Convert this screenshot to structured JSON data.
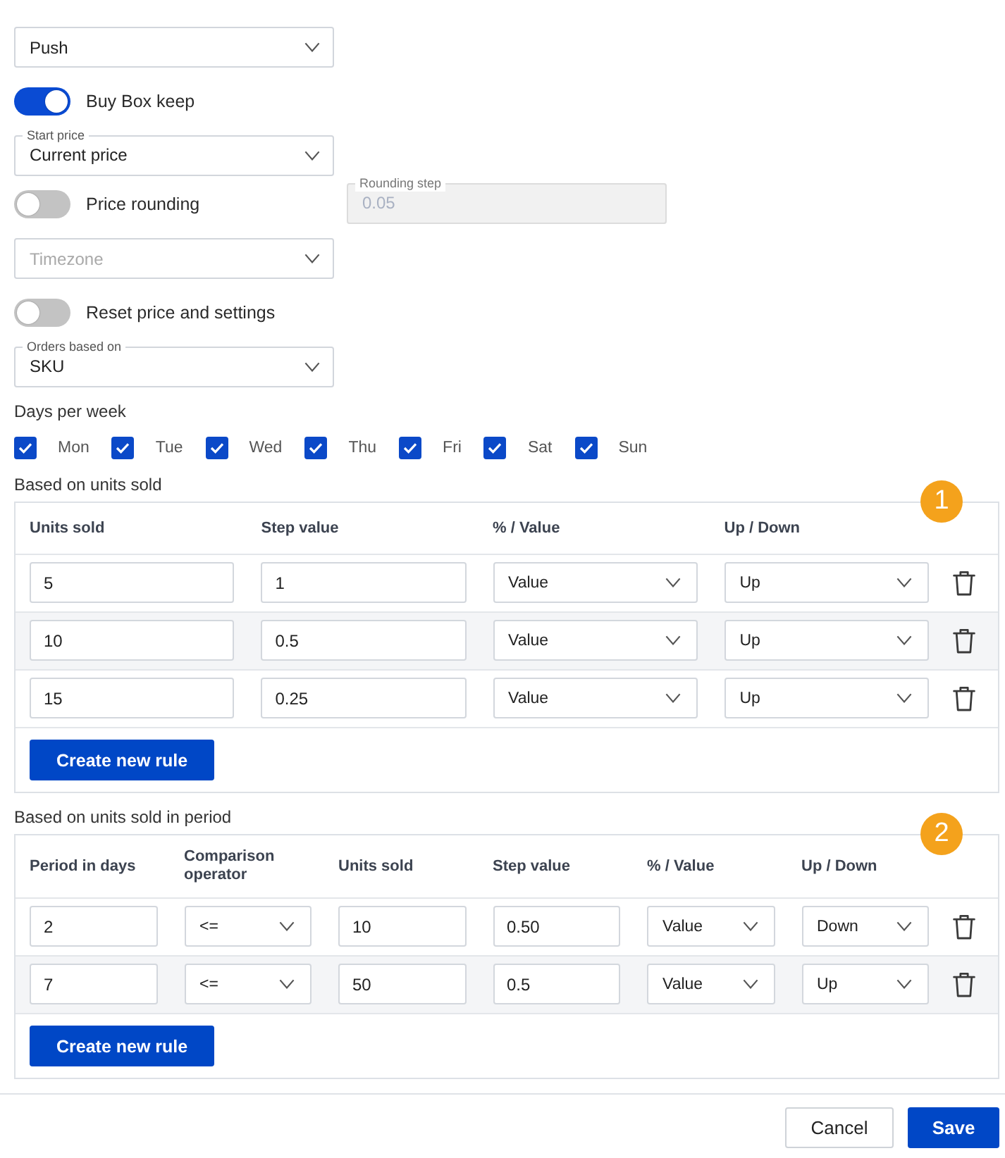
{
  "settings": [
    {
      "kind": "select",
      "value": "Push"
    },
    {
      "kind": "toggle",
      "label": "Buy Box keep",
      "on": true
    },
    {
      "kind": "select",
      "label": "Start price",
      "value": "Current price"
    },
    {
      "kind": "toggle",
      "label": "Price rounding",
      "on": false,
      "field": {
        "label": "Rounding step",
        "value": "0.05",
        "disabled": true
      }
    },
    {
      "kind": "select",
      "placeholder": "Timezone"
    },
    {
      "kind": "toggle",
      "label": "Reset price and settings",
      "on": false
    },
    {
      "kind": "select",
      "label": "Orders based on",
      "value": "SKU"
    }
  ],
  "days_per_week": {
    "label": "Days per week",
    "days": [
      {
        "label": "Mon",
        "checked": true
      },
      {
        "label": "Tue",
        "checked": true
      },
      {
        "label": "Wed",
        "checked": true
      },
      {
        "label": "Thu",
        "checked": true
      },
      {
        "label": "Fri",
        "checked": true
      },
      {
        "label": "Sat",
        "checked": true
      },
      {
        "label": "Sun",
        "checked": true
      }
    ]
  },
  "rule_tables": [
    {
      "title": "Based on units sold",
      "badge": "1",
      "columns": [
        {
          "label": "Units sold",
          "kind": "input"
        },
        {
          "label": "Step value",
          "kind": "input"
        },
        {
          "label": "% / Value",
          "kind": "select"
        },
        {
          "label": "Up / Down",
          "kind": "select"
        }
      ],
      "rows": [
        {
          "cells": [
            "5",
            "1",
            "Value",
            "Up"
          ]
        },
        {
          "cells": [
            "10",
            "0.5",
            "Value",
            "Up"
          ]
        },
        {
          "cells": [
            "15",
            "0.25",
            "Value",
            "Up"
          ]
        }
      ],
      "button": "Create new rule"
    },
    {
      "title": "Based on units sold in period",
      "badge": "2",
      "columns": [
        {
          "label": "Period in days",
          "kind": "input"
        },
        {
          "label": "Comparison operator",
          "kind": "select"
        },
        {
          "label": "Units sold",
          "kind": "input"
        },
        {
          "label": "Step value",
          "kind": "input"
        },
        {
          "label": "% / Value",
          "kind": "select"
        },
        {
          "label": "Up / Down",
          "kind": "select"
        }
      ],
      "rows": [
        {
          "cells": [
            "2",
            "<=",
            "10",
            "0.50",
            "Value",
            "Down"
          ]
        },
        {
          "cells": [
            "7",
            "<=",
            "50",
            "0.5",
            "Value",
            "Up"
          ]
        }
      ],
      "button": "Create new rule"
    }
  ],
  "footer": {
    "buttons": [
      {
        "label": "Cancel",
        "kind": "cancel"
      },
      {
        "label": "Save",
        "kind": "save"
      }
    ]
  }
}
